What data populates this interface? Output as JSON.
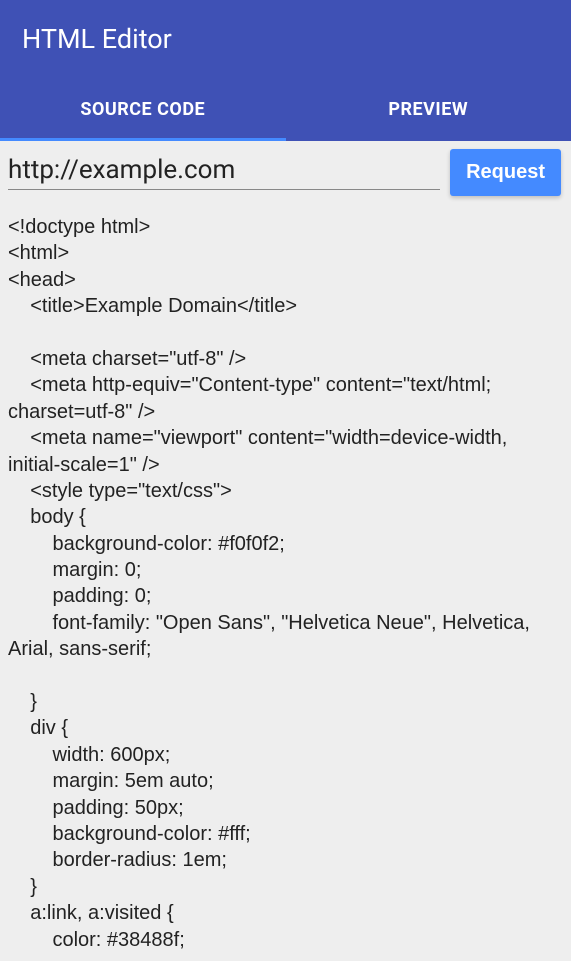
{
  "toolbar": {
    "title": "HTML Editor"
  },
  "tabs": {
    "source": "SOURCE CODE",
    "preview": "PREVIEW"
  },
  "urlbar": {
    "value": "http://example.com",
    "request_label": "Request"
  },
  "code": "<!doctype html>\n<html>\n<head>\n    <title>Example Domain</title>\n\n    <meta charset=\"utf-8\" />\n    <meta http-equiv=\"Content-type\" content=\"text/html; charset=utf-8\" />\n    <meta name=\"viewport\" content=\"width=device-width, initial-scale=1\" />\n    <style type=\"text/css\">\n    body {\n        background-color: #f0f0f2;\n        margin: 0;\n        padding: 0;\n        font-family: \"Open Sans\", \"Helvetica Neue\", Helvetica, Arial, sans-serif;\n        \n    }\n    div {\n        width: 600px;\n        margin: 5em auto;\n        padding: 50px;\n        background-color: #fff;\n        border-radius: 1em;\n    }\n    a:link, a:visited {\n        color: #38488f;"
}
